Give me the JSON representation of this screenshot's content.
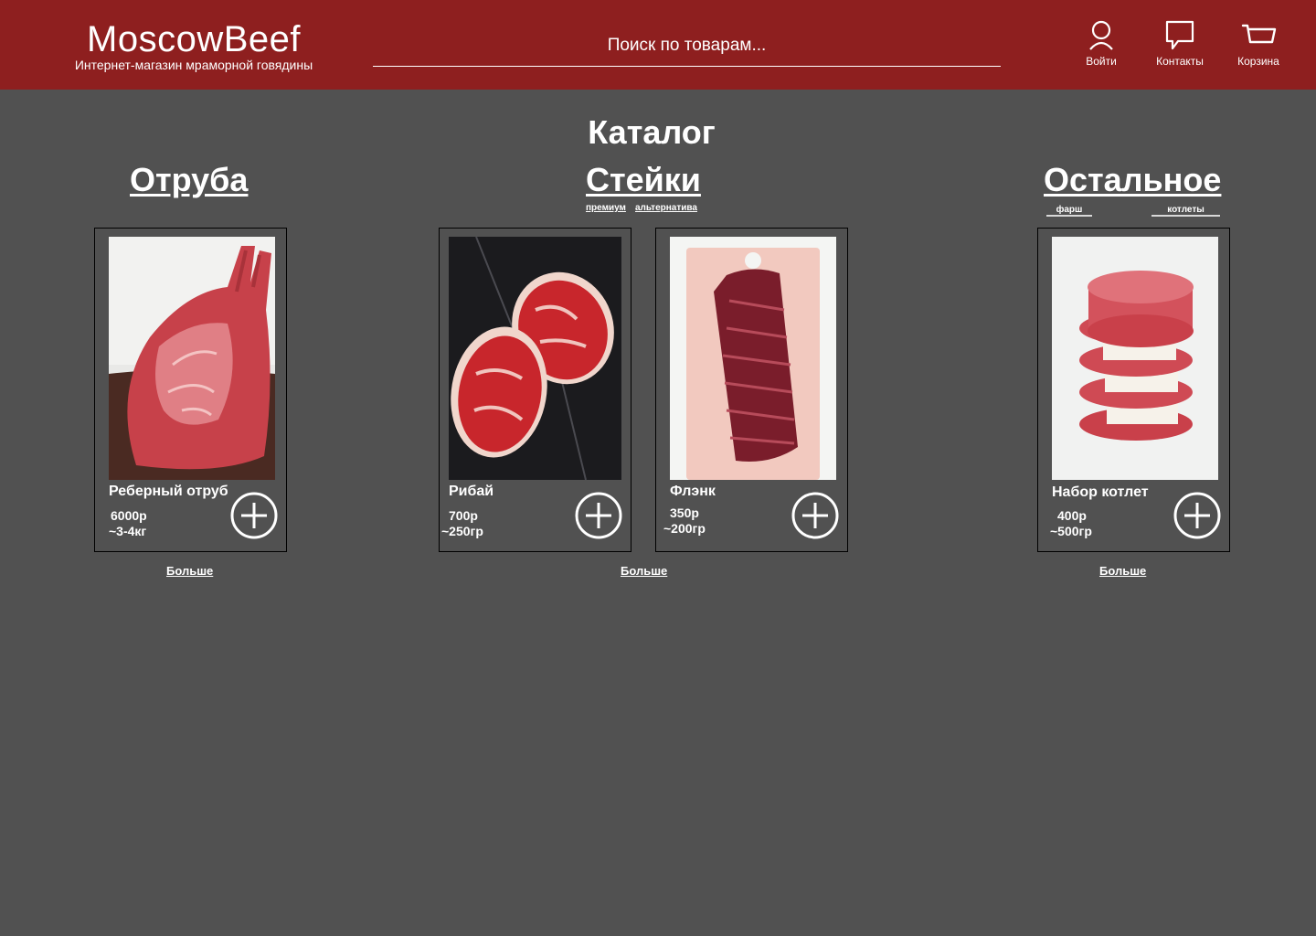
{
  "header": {
    "logo_title": "MoscowBeef",
    "logo_subtitle": "Интернет-магазин мраморной говядины",
    "search_placeholder": "Поиск по товарам...",
    "nav": {
      "login": "Войти",
      "contacts": "Контакты",
      "cart": "Корзина"
    }
  },
  "catalog": {
    "title": "Каталог",
    "categories": {
      "cuts": {
        "title": "Отруба",
        "more": "Больше"
      },
      "steaks": {
        "title": "Стейки",
        "tags": [
          "премиум",
          "альтернатива"
        ],
        "more": "Больше"
      },
      "other": {
        "title": "Остальное",
        "tags": [
          "фарш",
          "котлеты"
        ],
        "more": "Больше"
      }
    },
    "products": [
      {
        "name": "Реберный отруб",
        "price": "6000р",
        "weight": "~3-4кг"
      },
      {
        "name": "Рибай",
        "price": "700р",
        "weight": "~250гр"
      },
      {
        "name": "Флэнк",
        "price": "350р",
        "weight": "~200гр"
      },
      {
        "name": "Набор котлет",
        "price": "400р",
        "weight": "~500гр"
      }
    ]
  },
  "colors": {
    "header_bg": "#8e1f1f",
    "page_bg": "#515151",
    "text": "#ffffff"
  },
  "icons": [
    "user-icon",
    "chat-icon",
    "cart-icon",
    "plus-circle-icon"
  ]
}
